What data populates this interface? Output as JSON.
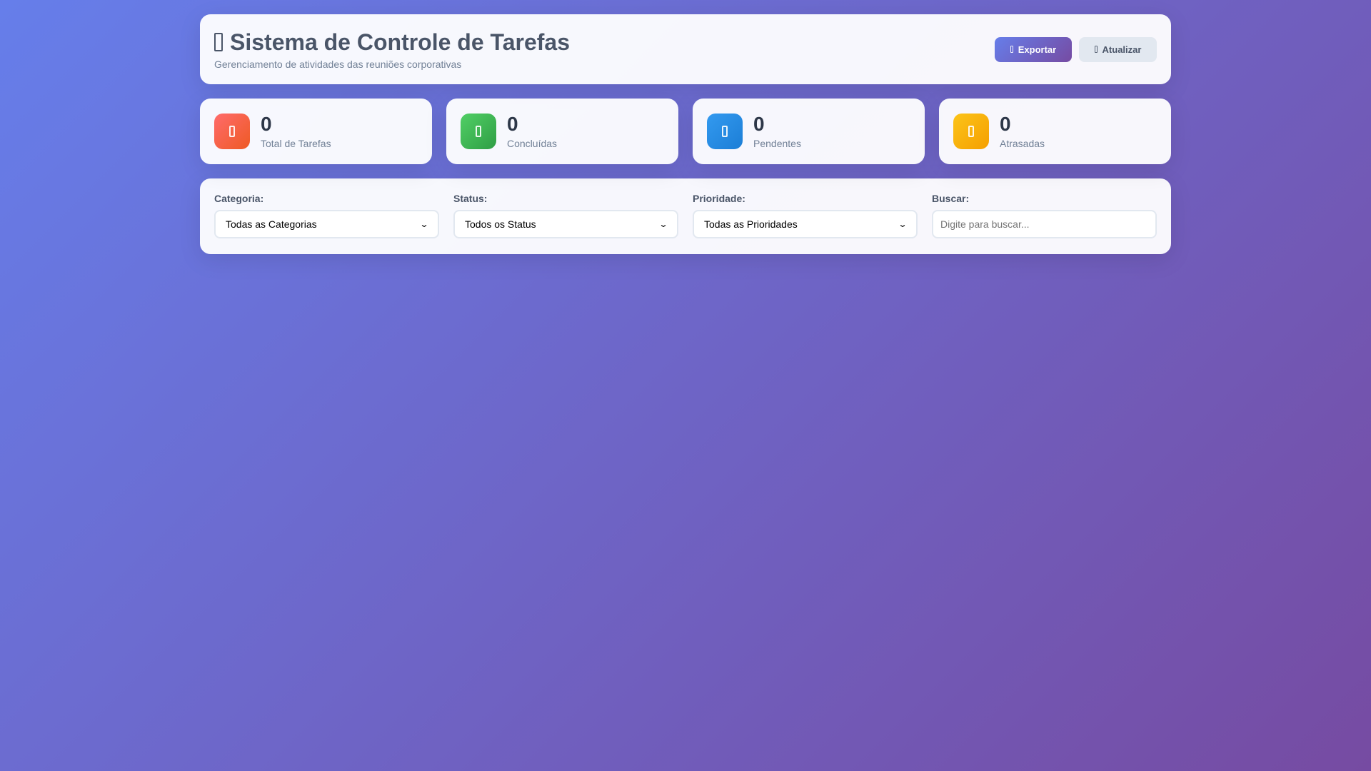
{
  "header": {
    "title": "Sistema de Controle de Tarefas",
    "subtitle": "Gerenciamento de atividades das reuniões corporativas",
    "title_icon": "clipboard-icon",
    "actions": {
      "export_label": "Exportar",
      "export_icon": "download-icon",
      "refresh_label": "Atualizar",
      "refresh_icon": "refresh-icon"
    }
  },
  "stats": [
    {
      "value": "0",
      "label": "Total de Tarefas",
      "icon": "tasks-icon",
      "color": "#ee5a24"
    },
    {
      "value": "0",
      "label": "Concluídas",
      "icon": "check-icon",
      "color": "#2f9e44"
    },
    {
      "value": "0",
      "label": "Pendentes",
      "icon": "clock-icon",
      "color": "#1c7ed6"
    },
    {
      "value": "0",
      "label": "Atrasadas",
      "icon": "warning-icon",
      "color": "#f59f00"
    }
  ],
  "filters": {
    "category": {
      "label": "Categoria:",
      "selected": "Todas as Categorias"
    },
    "status": {
      "label": "Status:",
      "selected": "Todos os Status"
    },
    "priority": {
      "label": "Prioridade:",
      "selected": "Todas as Prioridades"
    },
    "search": {
      "label": "Buscar:",
      "placeholder": "Digite para buscar...",
      "value": ""
    }
  },
  "colors": {
    "background_start": "#667eea",
    "background_end": "#764ba2",
    "text_primary": "#2d3748",
    "text_muted": "#718096"
  }
}
